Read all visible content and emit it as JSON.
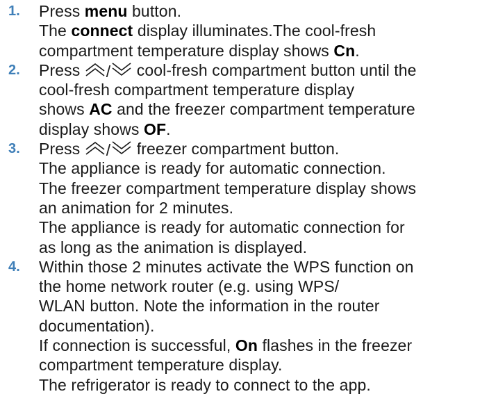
{
  "steps": [
    {
      "number": "1.",
      "lines": {
        "l1_pre": "Press ",
        "l1_bold": "menu",
        "l1_post": " button.",
        "l2_pre": "The ",
        "l2_bold": "connect",
        "l2_post": " display illuminates.The cool-fresh",
        "l3_pre": "compartment temperature display shows ",
        "l3_bold": "Cn",
        "l3_post": "."
      }
    },
    {
      "number": "2.",
      "lines": {
        "l1_pre": "Press ",
        "l1_slash": "/",
        "l1_post": " cool-fresh compartment button until the",
        "l2": "cool-fresh compartment temperature display",
        "l3_pre": "shows ",
        "l3_bold": "AC",
        "l3_post": " and the freezer compartment temperature",
        "l4_pre": "display shows ",
        "l4_bold": "OF",
        "l4_post": "."
      }
    },
    {
      "number": "3.",
      "lines": {
        "l1_pre": "Press ",
        "l1_slash": "/",
        "l1_post": " freezer compartment button.",
        "l2": "The appliance is ready for automatic connection.",
        "l3": "The freezer compartment temperature display shows",
        "l4": "an animation for 2 minutes.",
        "l5": "The appliance is ready for automatic connection for",
        "l6": "as long as the animation is displayed."
      }
    },
    {
      "number": "4.",
      "lines": {
        "l1": "Within those 2 minutes activate the WPS function on",
        "l2": "the home network router (e.g. using WPS/",
        "l3": "WLAN button. Note the information in the router",
        "l4": "documentation).",
        "l5_pre": "If connection is successful, ",
        "l5_bold": "On",
        "l5_post": " flashes in the freezer",
        "l6": "compartment temperature display.",
        "l7": "The refrigerator is ready to connect to the app."
      }
    }
  ],
  "colors": {
    "step_number": "#3f7fb8",
    "text": "#1a1a1a"
  },
  "icons": [
    "chevron-double-up-icon",
    "chevron-double-down-icon"
  ]
}
